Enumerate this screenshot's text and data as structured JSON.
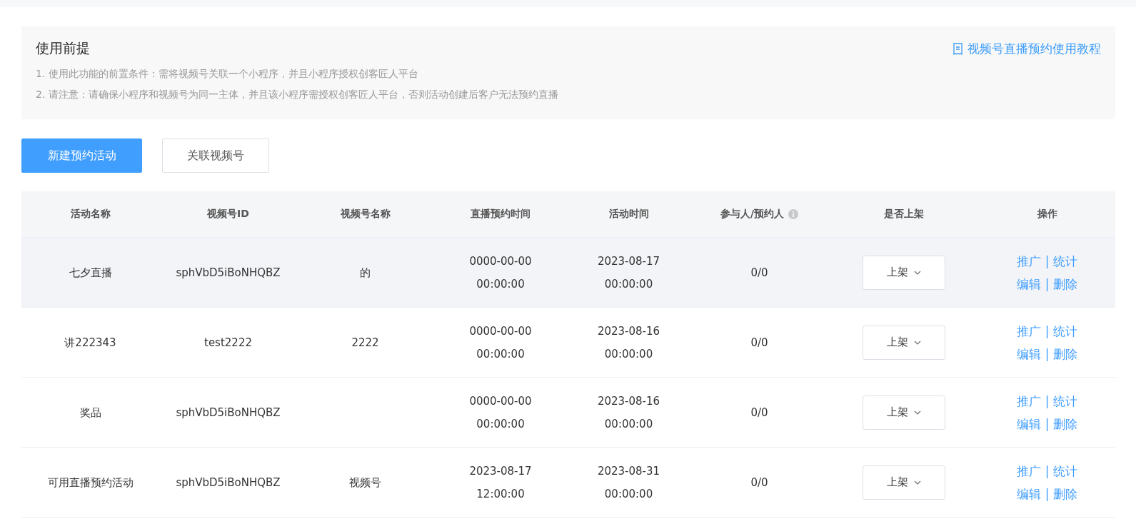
{
  "notice": {
    "title": "使用前提",
    "link": "视频号直播预约使用教程",
    "lines": [
      "1. 使用此功能的前置条件：需将视频号关联一个小程序，并且小程序授权创客匠人平台",
      "2. 请注意：请确保小程序和视频号为同一主体，并且该小程序需授权创客匠人平台，否则活动创建后客户无法预约直播"
    ]
  },
  "buttons": [
    {
      "label": "新建预约活动",
      "kind": "primary"
    },
    {
      "label": "关联视频号",
      "kind": "default"
    }
  ],
  "table": {
    "columns": [
      {
        "label": "活动名称"
      },
      {
        "label": "视频号ID"
      },
      {
        "label": "视频号名称"
      },
      {
        "label": "直播预约时间"
      },
      {
        "label": "活动时间"
      },
      {
        "label": "参与人/预约人",
        "info": true
      },
      {
        "label": "是否上架"
      },
      {
        "label": "操作"
      }
    ],
    "rows": [
      {
        "selected": true,
        "name": "七夕直播",
        "channel_id": "sphVbD5iBoNHQBZ",
        "channel_name": "的",
        "live_time": [
          "0000-00-00",
          "00:00:00"
        ],
        "activity_time": [
          "2023-08-17",
          "00:00:00"
        ],
        "participants": "0/0",
        "status": "上架",
        "actions": [
          {
            "left": "推广",
            "sep": "|",
            "right": "统计"
          },
          {
            "left": "编辑",
            "sep": "|",
            "right": "删除"
          }
        ]
      },
      {
        "selected": false,
        "name": "讲222343",
        "channel_id": "test2222",
        "channel_name": "2222",
        "live_time": [
          "0000-00-00",
          "00:00:00"
        ],
        "activity_time": [
          "2023-08-16",
          "00:00:00"
        ],
        "participants": "0/0",
        "status": "上架",
        "actions": [
          {
            "left": "推广",
            "sep": "|",
            "right": "统计"
          },
          {
            "left": "编辑",
            "sep": "|",
            "right": "删除"
          }
        ]
      },
      {
        "selected": false,
        "name": "奖品",
        "channel_id": "sphVbD5iBoNHQBZ",
        "live_time": [
          "0000-00-00",
          "00:00:00"
        ],
        "activity_time": [
          "2023-08-16",
          "00:00:00"
        ],
        "participants": "0/0",
        "status": "上架",
        "actions": [
          {
            "left": "推广",
            "sep": "|",
            "right": "统计"
          },
          {
            "left": "编辑",
            "sep": "|",
            "right": "删除"
          }
        ]
      },
      {
        "selected": false,
        "name": "可用直播预约活动",
        "channel_id": "sphVbD5iBoNHQBZ",
        "channel_name": "视频号",
        "live_time": [
          "2023-08-17",
          "12:00:00"
        ],
        "activity_time": [
          "2023-08-31",
          "00:00:00"
        ],
        "participants": "0/0",
        "status": "上架",
        "actions": [
          {
            "left": "推广",
            "sep": "|",
            "right": "统计"
          },
          {
            "left": "编辑",
            "sep": "|",
            "right": "删除"
          }
        ]
      }
    ]
  }
}
